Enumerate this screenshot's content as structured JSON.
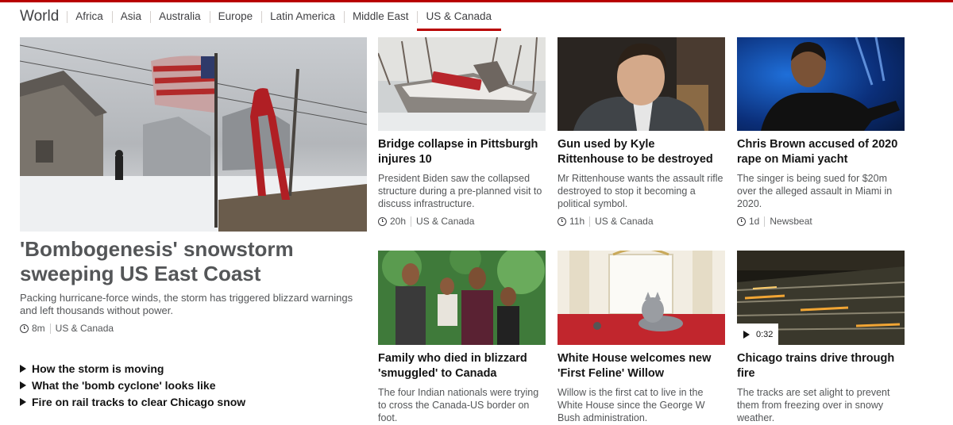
{
  "nav": {
    "section": "World",
    "items": [
      "Africa",
      "Asia",
      "Australia",
      "Europe",
      "Latin America",
      "Middle East",
      "US & Canada"
    ],
    "active": "US & Canada"
  },
  "lead": {
    "title": "'Bombogenesis' snowstorm sweeping US East Coast",
    "summary": "Packing hurricane-force winds, the storm has triggered blizzard warnings and left thousands without power.",
    "time": "8m",
    "tag": "US & Canada",
    "related": [
      "How the storm is moving",
      "What the 'bomb cyclone' looks like",
      "Fire on rail tracks to clear Chicago snow"
    ]
  },
  "cards": [
    {
      "title": "Bridge collapse in Pittsburgh injures 10",
      "summary": "President Biden saw the collapsed structure during a pre-planned visit to discuss infrastructure.",
      "time": "20h",
      "tag": "US & Canada"
    },
    {
      "title": "Gun used by Kyle Rittenhouse to be destroyed",
      "summary": "Mr Rittenhouse wants the assault rifle destroyed to stop it becoming a political symbol.",
      "time": "11h",
      "tag": "US & Canada"
    },
    {
      "title": "Chris Brown accused of 2020 rape on Miami yacht",
      "summary": "The singer is being sued for $20m over the alleged assault in Miami in 2020.",
      "time": "1d",
      "tag": "Newsbeat"
    },
    {
      "title": "Family who died in blizzard 'smuggled' to Canada",
      "summary": "The four Indian nationals were trying to cross the Canada-US border on foot."
    },
    {
      "title": "White House welcomes new 'First Feline' Willow",
      "summary": "Willow is the first cat to live in the White House since the George W Bush administration."
    },
    {
      "title": "Chicago trains drive through fire",
      "summary": "The tracks are set alight to prevent them from freezing over in snowy weather.",
      "video_duration": "0:32"
    }
  ],
  "icons": [
    "clock-icon",
    "play-icon",
    "triangle-bullet-icon"
  ],
  "colors": {
    "accent": "#b80000",
    "text": "#141414",
    "muted": "#545658"
  }
}
